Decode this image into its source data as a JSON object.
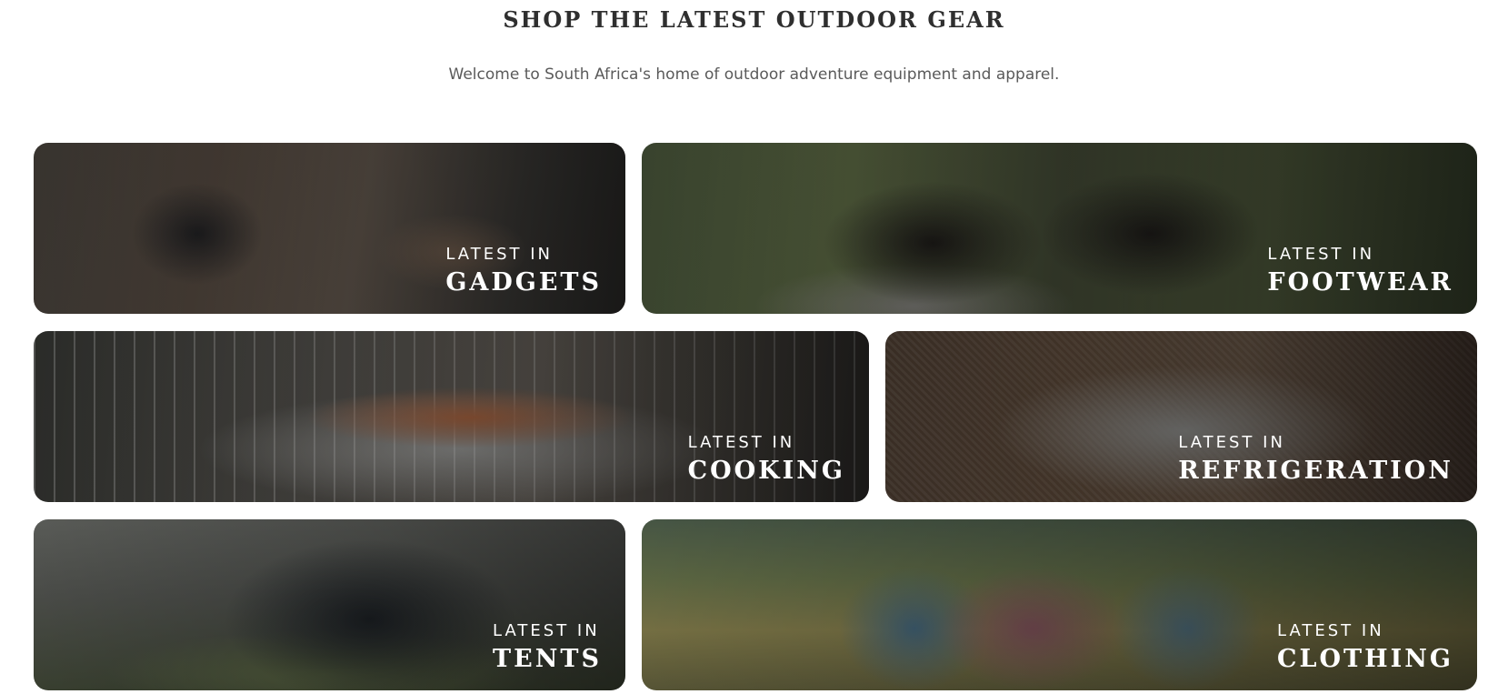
{
  "header": {
    "title": "SHOP THE LATEST OUTDOOR GEAR",
    "subtitle": "Welcome to South Africa's home of outdoor adventure equipment and apparel."
  },
  "categories": [
    {
      "kicker": "LATEST IN",
      "label": "GADGETS"
    },
    {
      "kicker": "LATEST IN",
      "label": "FOOTWEAR"
    },
    {
      "kicker": "LATEST IN",
      "label": "COOKING"
    },
    {
      "kicker": "LATEST IN",
      "label": "REFRIGERATION"
    },
    {
      "kicker": "LATEST IN",
      "label": "TENTS"
    },
    {
      "kicker": "LATEST IN",
      "label": "CLOTHING"
    }
  ]
}
